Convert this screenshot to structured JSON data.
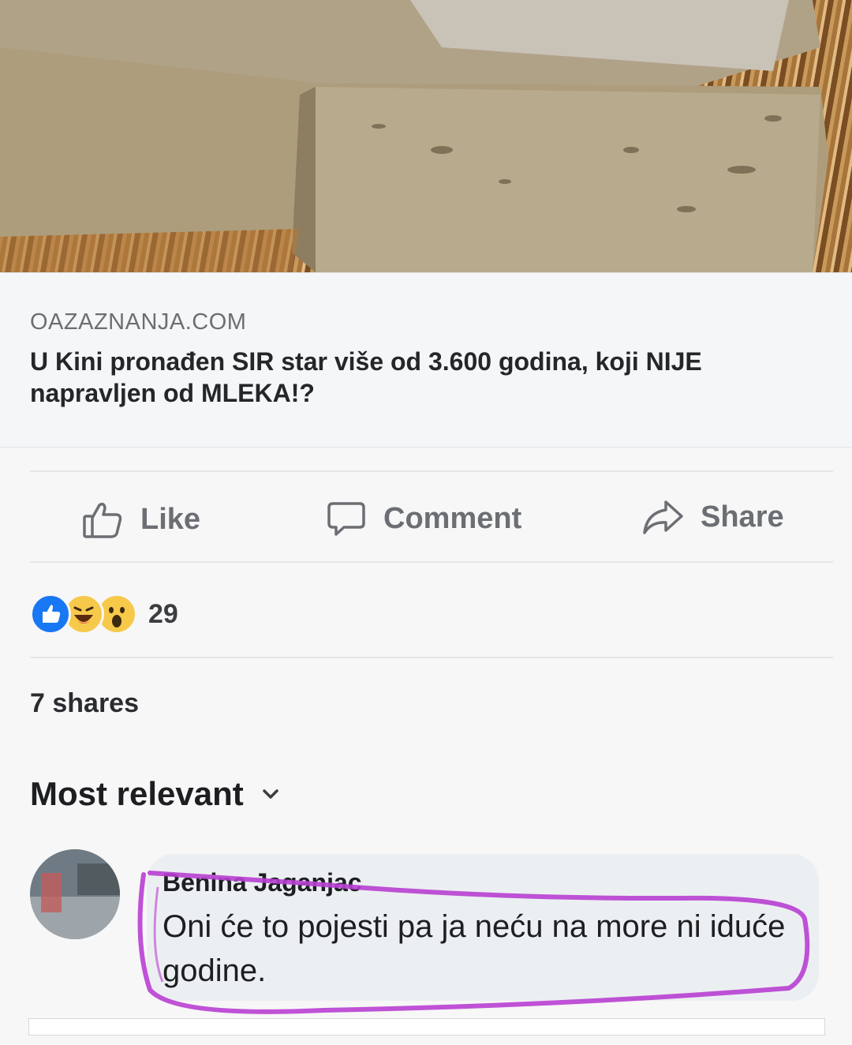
{
  "link_preview": {
    "domain": "OAZAZNANJA.COM",
    "headline": "U Kini pronađen SIR star više od 3.600 godina, koji NIJE napravljen od MLEKA!?"
  },
  "actions": {
    "like_label": "Like",
    "comment_label": "Comment",
    "share_label": "Share",
    "like_icon": "thumbs-up-outline",
    "comment_icon": "speech-bubble-outline",
    "share_icon": "share-arrow-outline"
  },
  "reactions": {
    "icons": [
      "like-reaction",
      "haha-reaction",
      "wow-reaction"
    ],
    "count": "29"
  },
  "shares": "7 shares",
  "comments_sort": {
    "label": "Most relevant",
    "icon": "chevron-down-icon"
  },
  "comment": {
    "author": "Benina Jaganjac",
    "text": "Oni će to pojesti pa ja neću na more ni iduće godine.",
    "highlight_color": "#b83fd1"
  },
  "colors": {
    "like_blue": "#1877f2",
    "emoji_yellow": "#f7c94b"
  }
}
